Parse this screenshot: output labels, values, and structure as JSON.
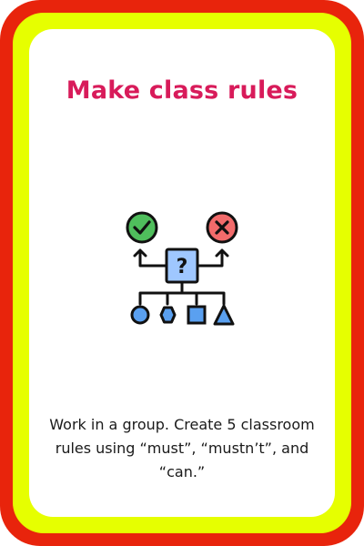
{
  "card": {
    "title": "Make class rules",
    "instructions": "Work in a group. Create 5 classroom rules using “must”, “mustn’t”, and “can.”",
    "colors": {
      "outer_border": "#e8240c",
      "inner_border": "#e6ff00",
      "background": "#ffffff",
      "title": "#d81b5a"
    }
  },
  "icon": {
    "name": "decision-tree-icon",
    "center_symbol": "?"
  }
}
